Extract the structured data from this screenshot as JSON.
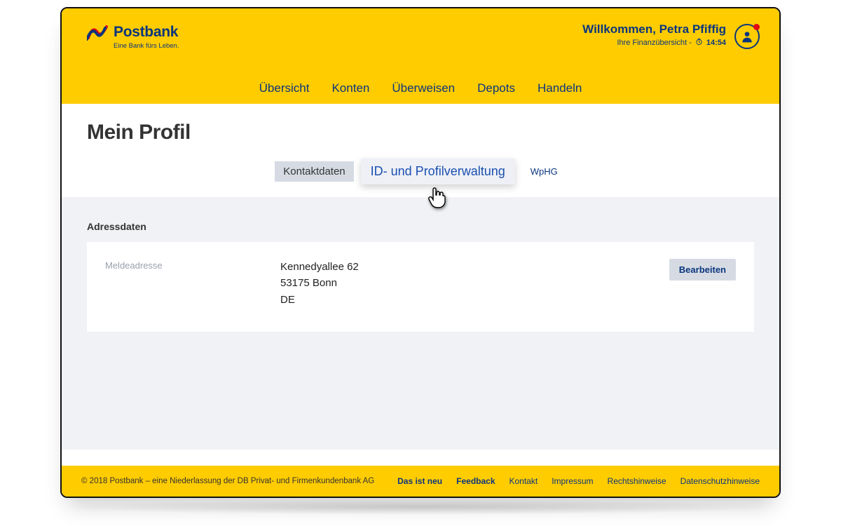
{
  "brand": {
    "name": "Postbank",
    "tagline": "Eine Bank fürs Leben."
  },
  "welcome": {
    "greeting": "Willkommen, Petra Pfiffig",
    "subline_prefix": "Ihre Finanzübersicht - ",
    "time": "14:54"
  },
  "nav": {
    "items": [
      "Übersicht",
      "Konten",
      "Überweisen",
      "Depots",
      "Handeln"
    ]
  },
  "page": {
    "title": "Mein Profil"
  },
  "subtabs": {
    "items": [
      {
        "label": "Kontaktdaten",
        "state": "active"
      },
      {
        "label": "ID- und Profilverwaltung",
        "state": "hover"
      },
      {
        "label": "WpHG",
        "state": "normal"
      }
    ]
  },
  "section": {
    "heading": "Adressdaten",
    "field_label": "Meldeadresse",
    "address_line1": "Kennedyallee 62",
    "address_line2": "53175 Bonn",
    "address_line3": "DE",
    "edit_label": "Bearbeiten"
  },
  "footer": {
    "copyright": "© 2018 Postbank – eine Niederlassung der DB Privat- und Firmenkundenbank AG",
    "links": [
      {
        "label": "Das ist neu",
        "strong": true
      },
      {
        "label": "Feedback",
        "strong": true
      },
      {
        "label": "Kontakt",
        "strong": false
      },
      {
        "label": "Impressum",
        "strong": false
      },
      {
        "label": "Rechtshinweise",
        "strong": false
      },
      {
        "label": "Datenschutzhinweise",
        "strong": false
      }
    ]
  }
}
